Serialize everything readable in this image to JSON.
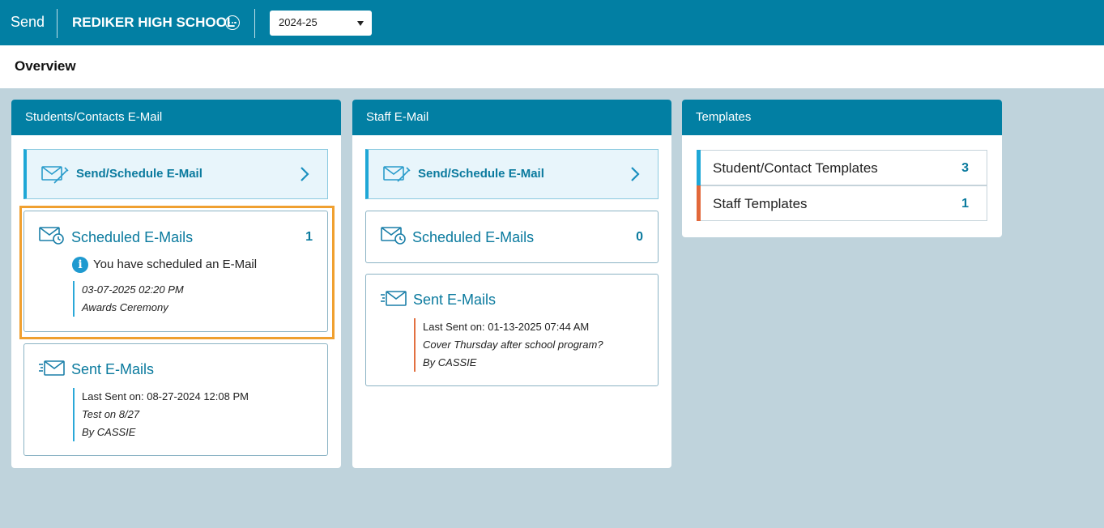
{
  "topbar": {
    "app_name": "Send",
    "school_name": "REDIKER HIGH SCHOOL",
    "year": "2024-25",
    "more_icon": "ellipsis-circle-icon"
  },
  "page": {
    "title": "Overview"
  },
  "students_panel": {
    "title": "Students/Contacts E-Mail",
    "send_label": "Send/Schedule E-Mail",
    "scheduled": {
      "title": "Scheduled E-Mails",
      "count": "1",
      "notice": "You have scheduled an E-Mail",
      "date": "03-07-2025 02:20 PM",
      "subject": "Awards Ceremony"
    },
    "sent": {
      "title": "Sent E-Mails",
      "last_sent": "Last Sent on: 08-27-2024 12:08 PM",
      "subject": "Test on 8/27",
      "by": "By CASSIE"
    }
  },
  "staff_panel": {
    "title": "Staff E-Mail",
    "send_label": "Send/Schedule E-Mail",
    "scheduled": {
      "title": "Scheduled E-Mails",
      "count": "0"
    },
    "sent": {
      "title": "Sent E-Mails",
      "last_sent": "Last Sent on: 01-13-2025 07:44 AM",
      "subject": "Cover Thursday after school program?",
      "by": "By CASSIE"
    }
  },
  "templates_panel": {
    "title": "Templates",
    "items": [
      {
        "label": "Student/Contact Templates",
        "count": "3",
        "color": "#1ea7d6"
      },
      {
        "label": "Staff Templates",
        "count": "1",
        "color": "#e2683a"
      }
    ]
  },
  "colors": {
    "header": "#027fa3",
    "accent_text": "#0a7a9e",
    "highlight": "#f0a030",
    "background": "#bfd3dc"
  }
}
